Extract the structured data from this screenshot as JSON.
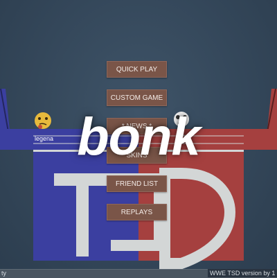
{
  "menu": {
    "quick_play": "QUICK PLAY",
    "custom_game": "CUSTOM GAME",
    "news": "* NEWS *",
    "skins": "SKINS",
    "friend_list": "FRIEND LIST",
    "replays": "REPLAYS"
  },
  "logo": {
    "text": "bonk"
  },
  "players": {
    "left_name": "legena",
    "right_name": "???"
  },
  "footer": {
    "left_text": "ty",
    "version": "WWE TSD version by 1"
  },
  "colors": {
    "blue_team": "#3b3fa0",
    "red_team": "#a5403f",
    "button": "#7a5548",
    "letters": "#d3d6d6"
  }
}
